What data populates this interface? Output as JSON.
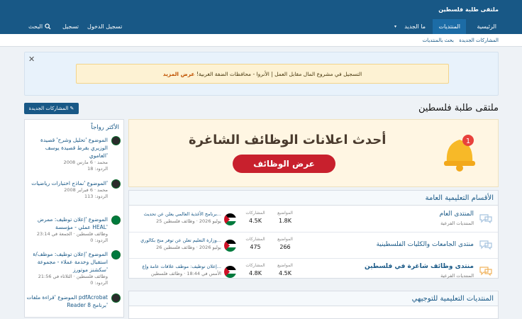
{
  "header": {
    "site_title": "ملتقى طلبة فلسطين"
  },
  "nav": {
    "home": "الرئيسية",
    "forums": "المنتديات",
    "whats_new": "ما الجديد",
    "login": "تسجيل الدخول",
    "register": "تسجيل",
    "search": "البحث"
  },
  "subnav": {
    "new_posts": "المشاركات الجديدة",
    "search_forums": "بحث بالمنتديات"
  },
  "notice": {
    "text": "التسجيل في مشروع المال مقابل العمل | الأنروا - محافظات الضفة الغربية! ",
    "link": "عرض المزيد"
  },
  "page": {
    "title": "ملتقى طلبة فلسطين",
    "new_posts_button": "المشاركات الجديدة"
  },
  "banner": {
    "headline": "أحدث اعلانات الوظائف الشاغرة",
    "button": "عرض الوظائف",
    "badge": "1"
  },
  "sidebar": {
    "title": "الأكثر رواجاً",
    "items": [
      {
        "title": "الموضوع 'تحليل وشرح' قصيدة الوزيري بقرط قصيدة يوسف العاموي'",
        "meta": "محمد · 6 مارس 2008",
        "replies": "الردود: 18"
      },
      {
        "title": "الموضوع 'نماذج اختبارات رياضيات'",
        "meta": "محمد · 6 فبراير 2008",
        "replies": "الردود: 113"
      },
      {
        "title": "الموضوع 'إعلان توظيف: ممرض عملي - مؤسسة HEAL'",
        "meta": "وظائف فلسطين · الجمعة في 23:14",
        "replies": "الردود: 0"
      },
      {
        "title": "الموضوع 'إعلان توظيف: موظف/ة استقبال وخدمة عملاء - مجموعة سكشنز موتورز'",
        "meta": "وظائف فلسطين · الثلاثاء في 21:56",
        "replies": "الردود: 0"
      },
      {
        "title": "الموضوع 'قراءة ملفات pdfAcrobat Reader 8 برنامج'",
        "meta": "",
        "replies": ""
      }
    ]
  },
  "sections": [
    {
      "title": "الأقسام التعليمية العامة",
      "forums": [
        {
          "title": "المنتدى العام",
          "sub": "المنتديات الفرعية",
          "threads_label": "المواضيع",
          "threads": "1.8K",
          "posts_label": "المشاركات",
          "posts": "4.5K",
          "latest_title": "برنامج الأغذية العالمي يعلن عن تحديث...",
          "latest_meta": "25 يوليو 2026 · وظائف فلسطين"
        },
        {
          "title": "منتدى الجامعات والكليات الفلسطينية",
          "sub": "",
          "threads_label": "المواضيع",
          "threads": "266",
          "posts_label": "المشاركات",
          "posts": "475",
          "latest_title": "وزارة التعليم تعلن عن توفر منح بكالوري...",
          "latest_meta": "26 يوليو 2026 · وظائف فلسطين"
        },
        {
          "title": "منتدى وظائف شاغرة في فلسطين",
          "sub": "المنتديات الفرعية",
          "threads_label": "المواضيع",
          "threads": "4.5K",
          "posts_label": "المشاركات",
          "posts": "4.8K",
          "latest_title": "إعلان توظيف: موظف علاقات عامة وإع...",
          "latest_meta": "الأمس في 18:44 · وظائف فلسطين"
        }
      ]
    },
    {
      "title": "المنتديات التعليمية للتوجيهي",
      "forums": []
    }
  ],
  "colors": {
    "brand": "#185886",
    "accent_red": "#c8202d",
    "notice_bg": "#fdf2d3"
  }
}
